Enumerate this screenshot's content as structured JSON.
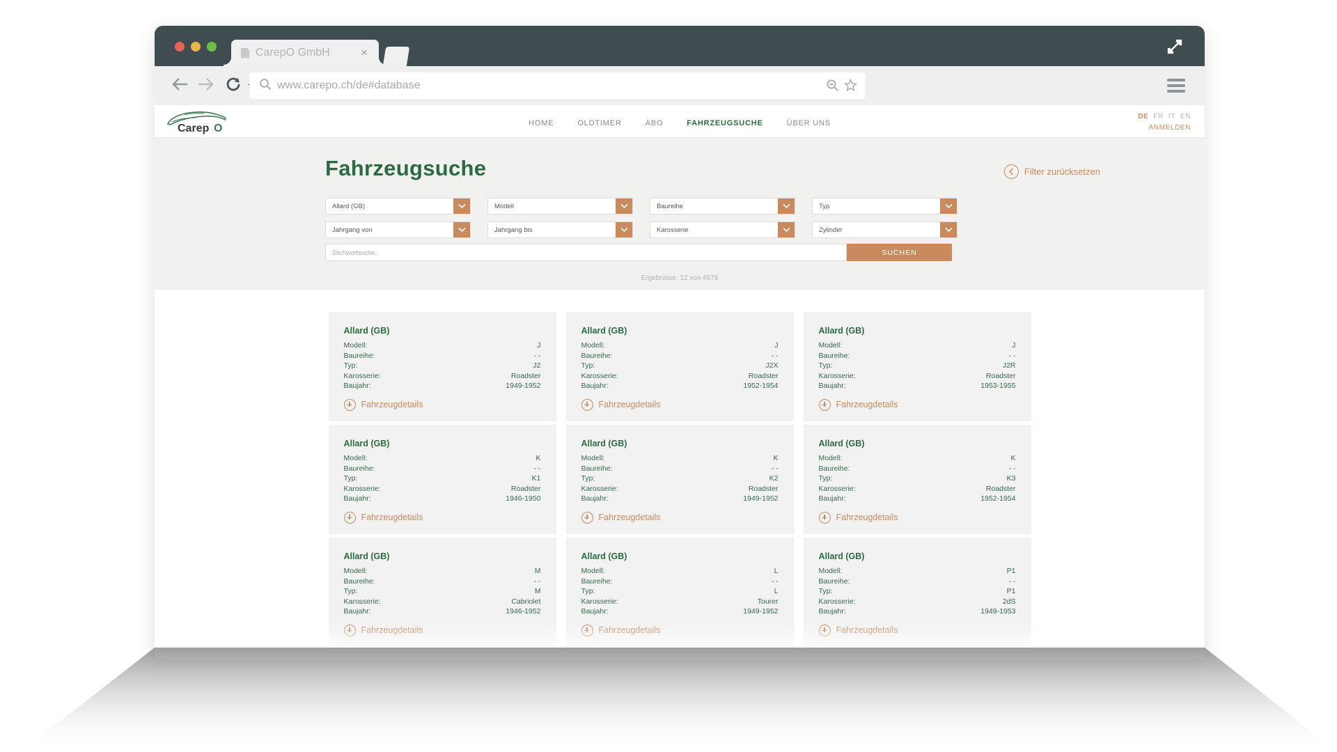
{
  "browser": {
    "tab_title": "CarepO GmbH",
    "tab_close_glyph": "×",
    "url": "www.carepo.ch/de#database",
    "icons": {
      "back": "back-arrow-icon",
      "forward": "forward-arrow-icon",
      "reload": "reload-icon",
      "home": "home-icon",
      "url_search": "search-icon",
      "zoom_out": "zoom-out-icon",
      "bookmark": "star-icon",
      "menu": "hamburger-menu-icon",
      "maximize": "maximize-icon",
      "tab_file": "file-icon",
      "new_tab": "new-tab-icon"
    }
  },
  "site": {
    "logo_text": "CarepO",
    "nav": [
      {
        "label": "HOME",
        "active": false
      },
      {
        "label": "OLDTIMER",
        "active": false
      },
      {
        "label": "ABO",
        "active": false
      },
      {
        "label": "FAHRZEUGSUCHE",
        "active": true
      },
      {
        "label": "ÜBER UNS",
        "active": false
      }
    ],
    "languages": [
      {
        "label": "DE",
        "active": true
      },
      {
        "label": "FR",
        "active": false
      },
      {
        "label": "IT",
        "active": false
      },
      {
        "label": "EN",
        "active": false
      }
    ],
    "login_label": "ANMELDEN"
  },
  "search_panel": {
    "title": "Fahrzeugsuche",
    "reset_label": "Filter zurücksetzen",
    "reset_icon": "circle-back-arrow-icon",
    "filters": [
      {
        "name": "marke",
        "value": "Allard (GB)",
        "selected": true
      },
      {
        "name": "modell",
        "value": "Modell",
        "selected": false
      },
      {
        "name": "baureihe",
        "value": "Baureihe",
        "selected": false
      },
      {
        "name": "typ",
        "value": "Typ",
        "selected": false
      },
      {
        "name": "jahrgang-von",
        "value": "Jahrgang von",
        "selected": false
      },
      {
        "name": "jahrgang-bis",
        "value": "Jahrgang bis",
        "selected": false
      },
      {
        "name": "karosserie",
        "value": "Karosserie",
        "selected": false
      },
      {
        "name": "zylinder",
        "value": "Zylinder",
        "selected": false
      }
    ],
    "keyword_placeholder": "Stichwortsuche..",
    "keyword_value": "",
    "submit_label": "SUCHEN",
    "results_count_label": "Ergebnisse: 12 von 4579"
  },
  "result_labels": {
    "modell": "Modell:",
    "baureihe": "Baureihe:",
    "typ": "Typ:",
    "karosserie": "Karosserie:",
    "baujahr": "Baujahr:",
    "details": "Fahrzeugdetails",
    "details_icon": "plus-circle-icon"
  },
  "results": [
    {
      "brand": "Allard (GB)",
      "modell": "J",
      "baureihe": "- -",
      "typ": "J2",
      "karosserie": "Roadster",
      "baujahr": "1949-1952"
    },
    {
      "brand": "Allard (GB)",
      "modell": "J",
      "baureihe": "- -",
      "typ": "J2X",
      "karosserie": "Roadster",
      "baujahr": "1952-1954"
    },
    {
      "brand": "Allard (GB)",
      "modell": "J",
      "baureihe": "- -",
      "typ": "J2R",
      "karosserie": "Roadster",
      "baujahr": "1953-1955"
    },
    {
      "brand": "Allard (GB)",
      "modell": "K",
      "baureihe": "- -",
      "typ": "K1",
      "karosserie": "Roadster",
      "baujahr": "1946-1950"
    },
    {
      "brand": "Allard (GB)",
      "modell": "K",
      "baureihe": "- -",
      "typ": "K2",
      "karosserie": "Roadster",
      "baujahr": "1949-1952"
    },
    {
      "brand": "Allard (GB)",
      "modell": "K",
      "baureihe": "- -",
      "typ": "K3",
      "karosserie": "Roadster",
      "baujahr": "1952-1954"
    },
    {
      "brand": "Allard (GB)",
      "modell": "M",
      "baureihe": "- -",
      "typ": "M",
      "karosserie": "Cabriolet",
      "baujahr": "1946-1952"
    },
    {
      "brand": "Allard (GB)",
      "modell": "L",
      "baureihe": "- -",
      "typ": "L",
      "karosserie": "Tourer",
      "baujahr": "1949-1952"
    },
    {
      "brand": "Allard (GB)",
      "modell": "P1",
      "baureihe": "- -",
      "typ": "P1",
      "karosserie": "2dS",
      "baujahr": "1949-1953"
    }
  ],
  "colors": {
    "brand_green": "#2c6b3f",
    "accent_orange": "#c98a5d",
    "chrome_dark": "#3f4c50",
    "panel_grey": "#f1f1f0",
    "card_grey": "#f2f2f2"
  }
}
